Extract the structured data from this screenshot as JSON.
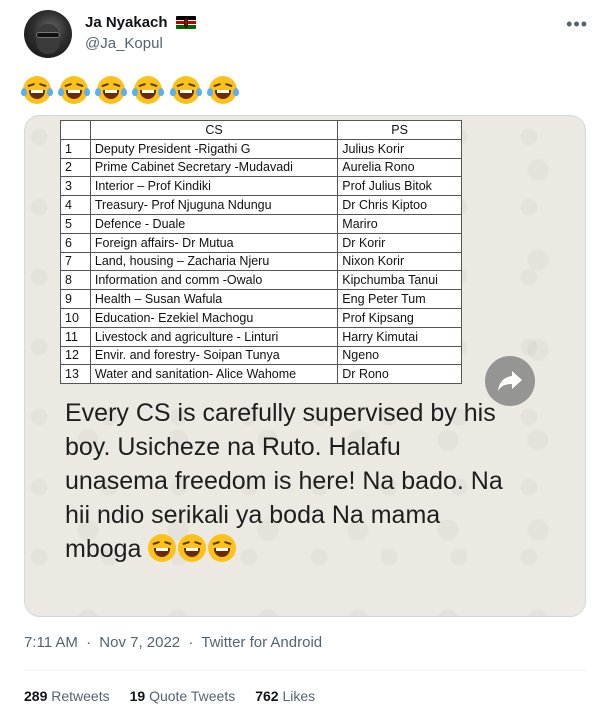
{
  "author": {
    "display_name": "Ja Nyakach",
    "handle": "@Ja_Kopul",
    "flag_icon": "kenya-flag-icon"
  },
  "more_icon": "more-horizontal-icon",
  "tweet": {
    "emoji_icon": "face-with-tears-of-joy-icon",
    "emoji_count": 6
  },
  "media": {
    "table": {
      "headers": [
        "",
        "CS",
        "PS"
      ],
      "rows": [
        [
          "1",
          "Deputy President -Rigathi G",
          "Julius Korir"
        ],
        [
          "2",
          "Prime Cabinet Secretary -Mudavadi",
          "Aurelia Rono"
        ],
        [
          "3",
          "Interior – Prof Kindiki",
          "Prof Julius Bitok"
        ],
        [
          "4",
          "Treasury- Prof Njuguna Ndungu",
          "Dr Chris Kiptoo"
        ],
        [
          "5",
          "Defence - Duale",
          "Mariro"
        ],
        [
          "6",
          "Foreign affairs- Dr Mutua",
          "Dr Korir"
        ],
        [
          "7",
          "Land, housing – Zacharia Njeru",
          "Nixon Korir"
        ],
        [
          "8",
          "Information and comm -Owalo",
          "Kipchumba Tanui"
        ],
        [
          "9",
          "Health – Susan Wafula",
          "Eng Peter Tum"
        ],
        [
          "10",
          "Education- Ezekiel Machogu",
          "Prof Kipsang"
        ],
        [
          "11",
          "Livestock and agriculture - Linturi",
          "Harry Kimutai"
        ],
        [
          "12",
          "Envir. and forestry- Soipan Tunya",
          "Ngeno"
        ],
        [
          "13",
          "Water and sanitation- Alice Wahome",
          "Dr Rono"
        ]
      ]
    },
    "caption": "Every CS is carefully supervised by his boy. Usicheze na Ruto. Halafu unasema freedom is here! Na bado. Na hii ndio serikali ya boda Na mama mboga",
    "caption_emoji_icon": "grinning-squinting-face-icon",
    "caption_emoji_count": 3,
    "share_icon": "forward-arrow-icon"
  },
  "meta": {
    "time": "7:11 AM",
    "date": "Nov 7, 2022",
    "source": "Twitter for Android",
    "separator": "·"
  },
  "stats": {
    "retweets_count": "289",
    "retweets_label": "Retweets",
    "quotes_count": "19",
    "quotes_label": "Quote Tweets",
    "likes_count": "762",
    "likes_label": "Likes"
  }
}
